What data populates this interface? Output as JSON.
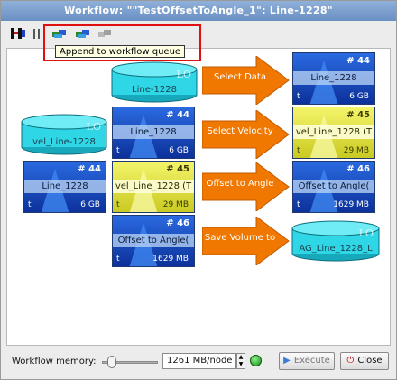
{
  "window": {
    "title": "Workflow: \"\"TestOffsetToAngle_1\": Line-1228\""
  },
  "toolbar": {
    "tooltip": "Append to workflow queue",
    "icons": [
      "workflow-icon",
      "info-icon",
      "append-queue-icon",
      "run-icon",
      "disabled-run-icon"
    ]
  },
  "canvas": {
    "inputs": [
      {
        "label": "Line-1228",
        "badge": "LO"
      },
      {
        "label": "vel_Line-1228",
        "badge": "LO"
      }
    ],
    "rows": [
      {
        "inputs": [],
        "step": "Select Data",
        "output": {
          "kind": "tile",
          "color": "blue",
          "num": "# 44",
          "name": "Line_1228",
          "t": "t",
          "size": "6 GB"
        }
      },
      {
        "inputs": [
          {
            "color": "blue",
            "num": "# 44",
            "name": "Line_1228",
            "t": "t",
            "size": "6 GB"
          }
        ],
        "step": "Select Velocity",
        "output": {
          "kind": "tile",
          "color": "yellow",
          "num": "# 45",
          "name": "vel_Line_1228 (T",
          "t": "t",
          "size": "29 MB"
        }
      },
      {
        "inputs": [
          {
            "color": "blue",
            "num": "# 44",
            "name": "Line_1228",
            "t": "t",
            "size": "6 GB"
          },
          {
            "color": "yellow",
            "num": "# 45",
            "name": "vel_Line_1228 (T",
            "t": "t",
            "size": "29 MB"
          }
        ],
        "step": "Offset to Angle",
        "output": {
          "kind": "tile",
          "color": "blue",
          "num": "# 46",
          "name": "Offset to Angle(",
          "t": "t",
          "size": "1629 MB"
        }
      },
      {
        "inputs": [
          {
            "color": "blue",
            "num": "# 46",
            "name": "Offset to Angle(",
            "t": "t",
            "size": "1629 MB"
          }
        ],
        "step": "Save Volume to",
        "output": {
          "kind": "cyl",
          "label": "AG_Line_1228_L",
          "badge": "LO"
        }
      }
    ]
  },
  "status": {
    "memory_label": "Workflow memory:",
    "memory_value": "1261 MB/node",
    "execute_label": "Execute",
    "close_label": "Close"
  },
  "colors": {
    "accent_red": "#e01010",
    "arrow_orange": "#f07800",
    "tile_blue": "#1848c0",
    "tile_yellow": "#e8e838",
    "cyl_cyan": "#2fd6e6"
  }
}
